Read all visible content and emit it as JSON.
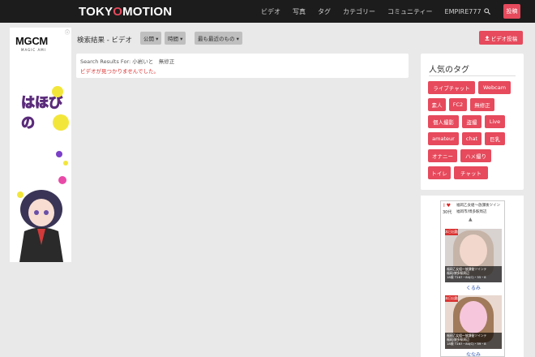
{
  "nav": {
    "logo_left": "TOKY",
    "logo_o": "O",
    "logo_right": "MOTION",
    "items": [
      "ビデオ",
      "写真",
      "タグ",
      "カテゴリー",
      "コミュニティー",
      "EMPIRE777"
    ],
    "login_label": "投稿"
  },
  "ad_left": {
    "info": "ⓘ",
    "logo_text": "MGCM",
    "logo_sub": "MAGIC AMI",
    "tagline": "はほびの"
  },
  "main": {
    "title": "検索結果 - ビデオ",
    "filters": [
      "公開 ▾",
      "時間 ▾",
      "最も最近のもの ▾"
    ],
    "upload_label": "ビデオ投稿",
    "results_for_label": "Search Results For:",
    "query": "小岩いと　無修正",
    "no_results": "ビデオが見つかりませんでした。"
  },
  "tags": {
    "title": "人気のタグ",
    "items": [
      "ライブチャット",
      "Webcam",
      "素人",
      "FC2",
      "無修正",
      "個人撮影",
      "盗撮",
      "Live",
      "amateur",
      "chat",
      "巨乳",
      "オナニー",
      "ハメ撮り",
      "トイレ",
      "チャット"
    ]
  },
  "ad_right": {
    "heart": "I ♥",
    "age": "30代",
    "headline": "福岡乙女組～放課後ツイン",
    "subline": "福岡市/博多駅周辺",
    "cards": [
      {
        "badge": "本日出勤",
        "caption1": "福岡乙女組～放課後ツインテ",
        "caption2": "福岡/博多駅周辺",
        "caption3": "18歳 T167・84(C)・55・8",
        "name": "くるみ"
      },
      {
        "badge": "本日出勤",
        "caption1": "福岡乙女組～放課後ツインテ",
        "caption2": "福岡/博多駅周辺",
        "caption3": "18歳 T167・84(C)・59・8",
        "name": "ななみ"
      }
    ]
  },
  "colors": {
    "accent": "#e64a5c",
    "navbar": "#1c1c1c",
    "background": "#e9e9e9"
  }
}
